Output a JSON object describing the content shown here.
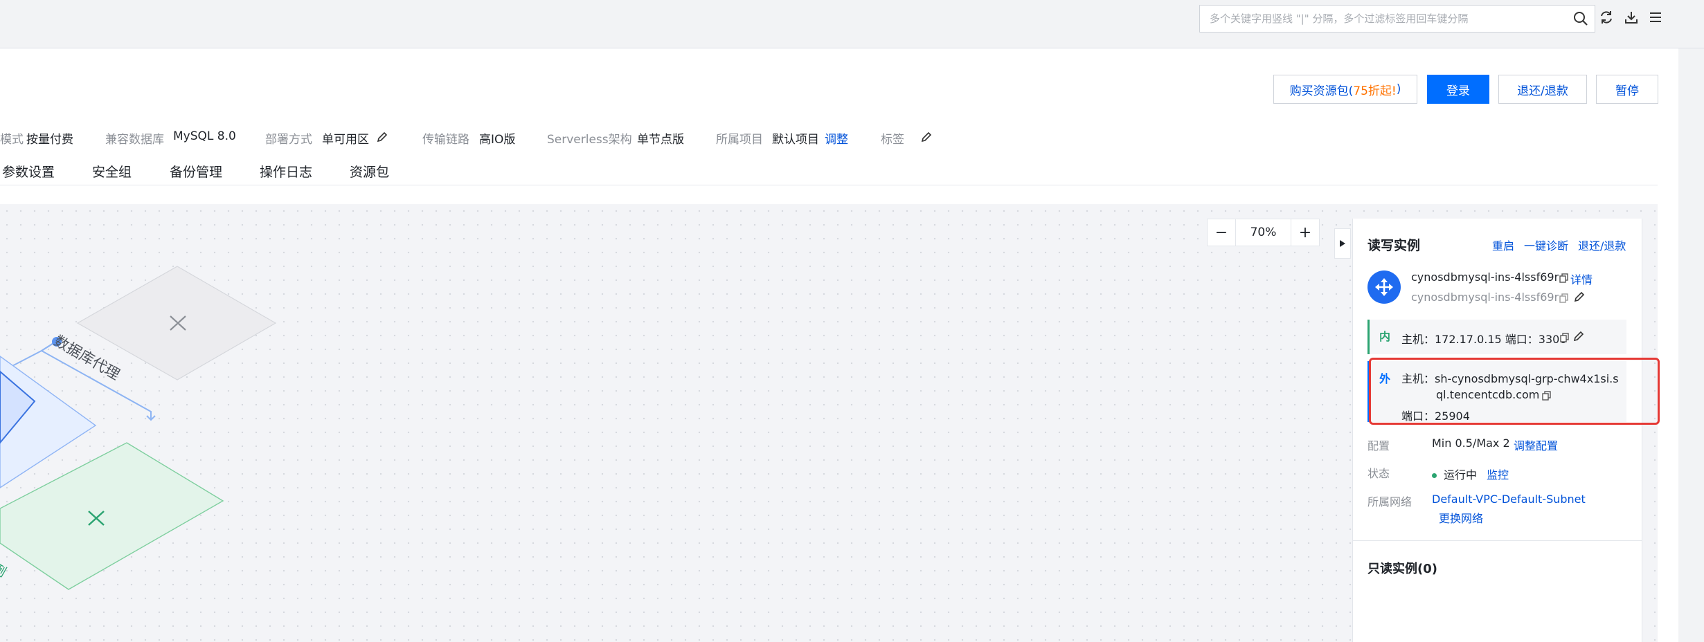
{
  "search": {
    "placeholder": "多个关键字用竖线 \"|\" 分隔，多个过滤标签用回车键分隔"
  },
  "toolbar_icons": [
    "search-icon",
    "refresh-icon",
    "download-icon",
    "menu-icon"
  ],
  "actions": {
    "buy_prefix": "购买资源包(",
    "buy_accent": "75折起!",
    "buy_suffix": ")",
    "login": "登录",
    "refund": "退还/退款",
    "pause": "暂停"
  },
  "info": {
    "billing_label_partial": "模式",
    "billing_value": "按量付费",
    "compat_label": "兼容数据库",
    "compat_value": "MySQL 8.0",
    "deploy_label": "部署方式",
    "deploy_value": "单可用区",
    "link_label": "传输链路",
    "link_value": "高IO版",
    "serverless_label": "Serverless架构",
    "serverless_value": "单节点版",
    "project_label": "所属项目",
    "project_value": "默认项目",
    "project_action": "调整",
    "tag_label": "标签"
  },
  "tabs": [
    "参数设置",
    "安全组",
    "备份管理",
    "操作日志",
    "资源包"
  ],
  "diagram": {
    "proxy_label": "数据库代理",
    "partial_label": "例"
  },
  "zoom": {
    "minus": "−",
    "value": "70%",
    "plus": "+"
  },
  "side": {
    "rw_title": "读写实例",
    "restart": "重启",
    "diagnose": "一键诊断",
    "refund": "退还/退款",
    "instance_id": "cynosdbmysql-ins-4lssf69r",
    "detail": "详情",
    "instance_name": "cynosdbmysql-ins-4lssf69r",
    "inner_badge": "内",
    "inner_host": "主机：172.17.0.15 端口：3306",
    "outer_badge": "外",
    "outer_host_line1": "主机：sh-cynosdbmysql-grp-chw4x1si.s",
    "outer_host_line2": "ql.tencentcdb.com",
    "outer_port": "端口：25904",
    "config_label": "配置",
    "config_value": "Min 0.5/Max 2",
    "config_action": "调整配置",
    "status_label": "状态",
    "status_value": "运行中",
    "status_action": "监控",
    "network_label": "所属网络",
    "network_value": "Default-VPC-Default-Subnet",
    "network_action": "更换网络",
    "ro_title": "只读实例(0)"
  },
  "colors": {
    "primary": "#006eff",
    "link": "#0052d9",
    "accent": "#ff7200",
    "highlight": "#e53935",
    "inner_green": "#2ba471",
    "proxy_gray": "#e9eaee",
    "ro_green": "#dff3e8"
  }
}
